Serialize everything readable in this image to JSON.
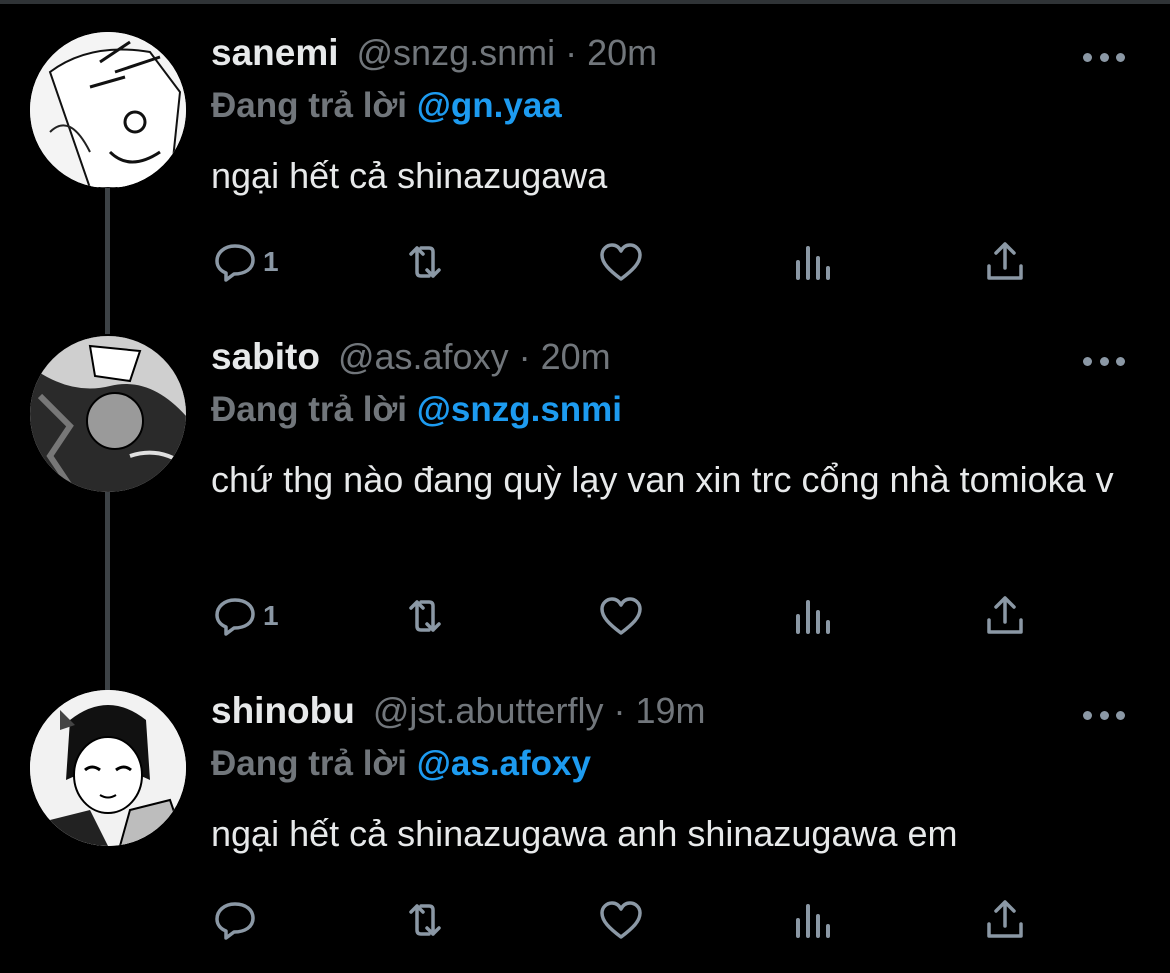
{
  "colors": {
    "background": "#000000",
    "text": "#e7e9ea",
    "secondary": "#71767b",
    "accent": "#1d9bf0",
    "icon": "#8b98a5"
  },
  "tweets": [
    {
      "name": "sanemi",
      "handle": "@snzg.snmi",
      "separator": "·",
      "time": "20m",
      "reply_prefix": "Đang trả lời",
      "reply_to": "@gn.yaa",
      "text": "ngại hết cả shinazugawa",
      "reply_count": "1",
      "avatar_icon": "avatar-image"
    },
    {
      "name": "sabito",
      "handle": "@as.afoxy",
      "separator": "·",
      "time": "20m",
      "reply_prefix": "Đang trả lời",
      "reply_to": "@snzg.snmi",
      "text": "chứ thg nào đang quỳ lạy van xin trc cổng nhà tomioka v",
      "reply_count": "1",
      "avatar_icon": "avatar-image"
    },
    {
      "name": "shinobu",
      "handle": "@jst.abutterfly",
      "separator": "·",
      "time": "19m",
      "reply_prefix": "Đang trả lời",
      "reply_to": "@as.afoxy",
      "text": "ngại hết cả shinazugawa anh shinazugawa em",
      "reply_count": "",
      "avatar_icon": "avatar-image"
    }
  ],
  "action_icons": [
    "reply-icon",
    "retweet-icon",
    "like-icon",
    "analytics-icon",
    "share-icon"
  ]
}
